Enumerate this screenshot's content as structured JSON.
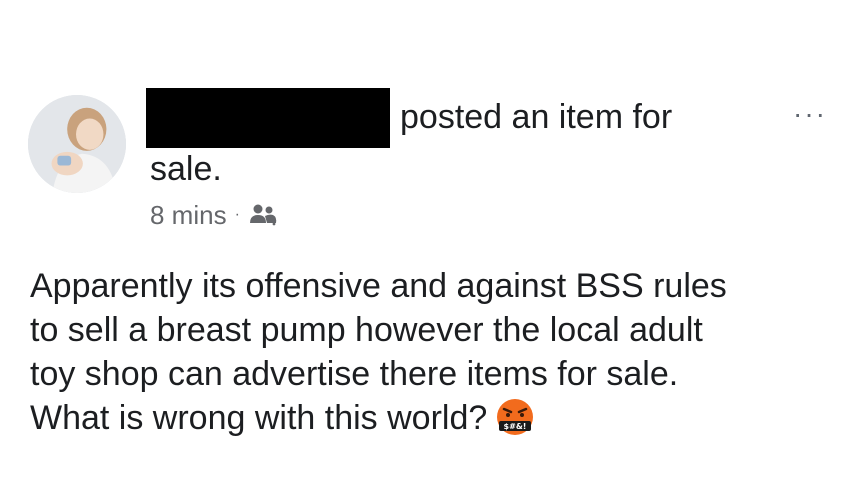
{
  "post": {
    "author_redacted": true,
    "action_text": "posted an item for",
    "action_text_cont": "sale.",
    "timestamp": "8 mins",
    "meta_separator": "·",
    "audience_icon": "group-icon",
    "more_label": "···",
    "body_lines": [
      "Apparently its offensive and against BSS rules",
      "to sell a breast pump however the local adult",
      "toy shop can advertise there items for sale.",
      "What is wrong with this world?"
    ],
    "emoji": "angry-face-emoji",
    "emoji_text": "$#&!"
  },
  "colors": {
    "text": "#1c1e21",
    "meta": "#65676b",
    "redaction": "#000000",
    "emoji_face": "#f26b1d"
  }
}
